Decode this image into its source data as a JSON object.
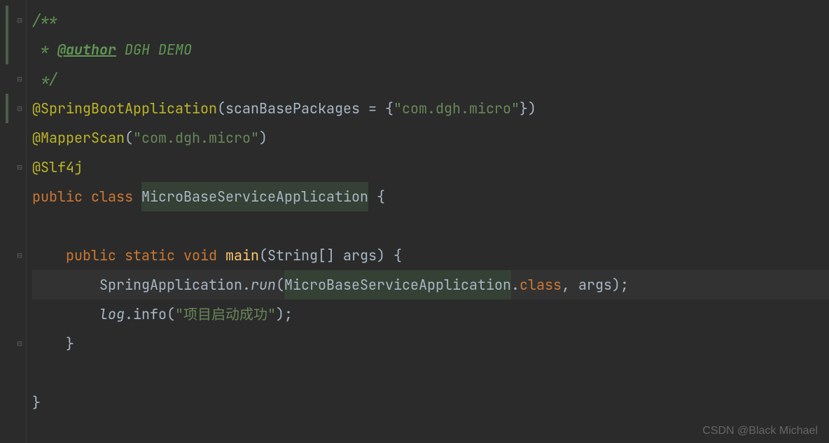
{
  "code": {
    "line1": "/**",
    "line2_star": " * ",
    "line2_tag": "@author",
    "line2_text": " DGH DEMO",
    "line3": " */",
    "line4_anno": "@SpringBootApplication",
    "line4_paren": "(",
    "line4_param": "scanBasePackages = {",
    "line4_string": "\"com.dgh.micro\"",
    "line4_close": "})",
    "line5_anno": "@MapperScan",
    "line5_paren": "(",
    "line5_string": "\"com.dgh.micro\"",
    "line5_close": ")",
    "line6_anno": "@Slf4j",
    "line7_public": "public ",
    "line7_class": "class ",
    "line7_name": "MicroBaseServiceApplication",
    "line7_brace": " {",
    "line9_indent": "    ",
    "line9_public": "public ",
    "line9_static": "static ",
    "line9_void": "void ",
    "line9_main": "main",
    "line9_params": "(String[] args) {",
    "line10_indent": "        ",
    "line10_class": "SpringApplication",
    "line10_dot": ".",
    "line10_run": "run",
    "line10_paren": "(",
    "line10_arg1": "MicroBaseServiceApplication",
    "line10_dot2": ".",
    "line10_classword": "class",
    "line10_comma": ", ",
    "line10_args": "args",
    "line10_close": ");",
    "line11_indent": "        ",
    "line11_log": "log",
    "line11_dot": ".",
    "line11_info": "info",
    "line11_paren": "(",
    "line11_string": "\"项目启动成功\"",
    "line11_close": ");",
    "line12_indent": "    ",
    "line12_brace": "}",
    "line14_brace": "}"
  },
  "watermark": "CSDN @Black Michael"
}
